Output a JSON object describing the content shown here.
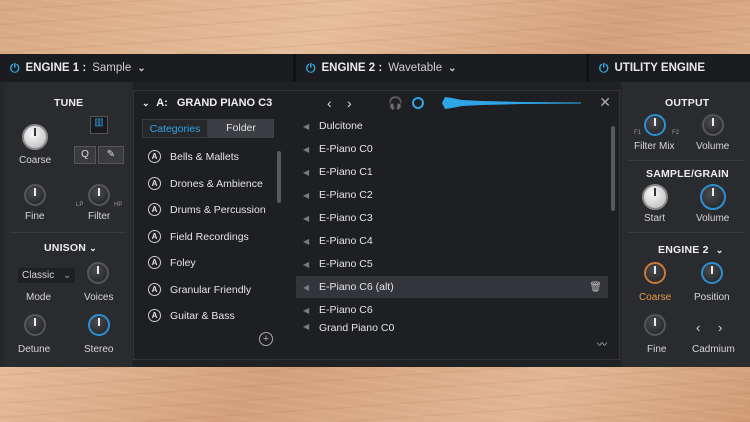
{
  "engine1": {
    "title": "ENGINE 1 :",
    "mode": "Sample"
  },
  "engine2": {
    "title": "ENGINE 2 :",
    "mode": "Wavetable"
  },
  "utility": {
    "title": "UTILITY ENGINE"
  },
  "tune": {
    "title": "TUNE",
    "coarse": "Coarse",
    "fine": "Fine",
    "filter": "Filter",
    "lp": "LP",
    "hp": "HP",
    "q": "Q"
  },
  "unison": {
    "title": "UNISON",
    "mode_value": "Classic",
    "mode": "Mode",
    "voices": "Voices",
    "detune": "Detune",
    "stereo": "Stereo"
  },
  "browser": {
    "preset_prefix": "A:",
    "preset_name": "GRAND PIANO C3",
    "tab_categories": "Categories",
    "tab_folder": "Folder",
    "categories": [
      "Bells & Mallets",
      "Drones & Ambience",
      "Drums & Percussion",
      "Field Recordings",
      "Foley",
      "Granular Friendly",
      "Guitar & Bass"
    ],
    "category_icon": "A",
    "presets": [
      "Dulcitone",
      "E-Piano C0",
      "E-Piano C1",
      "E-Piano C2",
      "E-Piano C3",
      "E-Piano C4",
      "E-Piano C5",
      "E-Piano C6 (alt)",
      "E-Piano C6",
      "Grand Piano C0"
    ],
    "selected_preset": "E-Piano C6 (alt)"
  },
  "output": {
    "title": "OUTPUT",
    "filter_mix": "Filter Mix",
    "volume": "Volume",
    "f1": "F1",
    "f2": "F2"
  },
  "sample_grain": {
    "title": "SAMPLE/GRAIN",
    "start": "Start",
    "volume": "Volume"
  },
  "engine2_panel": {
    "title": "ENGINE 2",
    "coarse": "Coarse",
    "position": "Position",
    "fine": "Fine",
    "cadmium": "Cadmium"
  },
  "colors": {
    "accent": "#2fa5e6",
    "orange": "#e8994a",
    "panel": "#26272b"
  }
}
